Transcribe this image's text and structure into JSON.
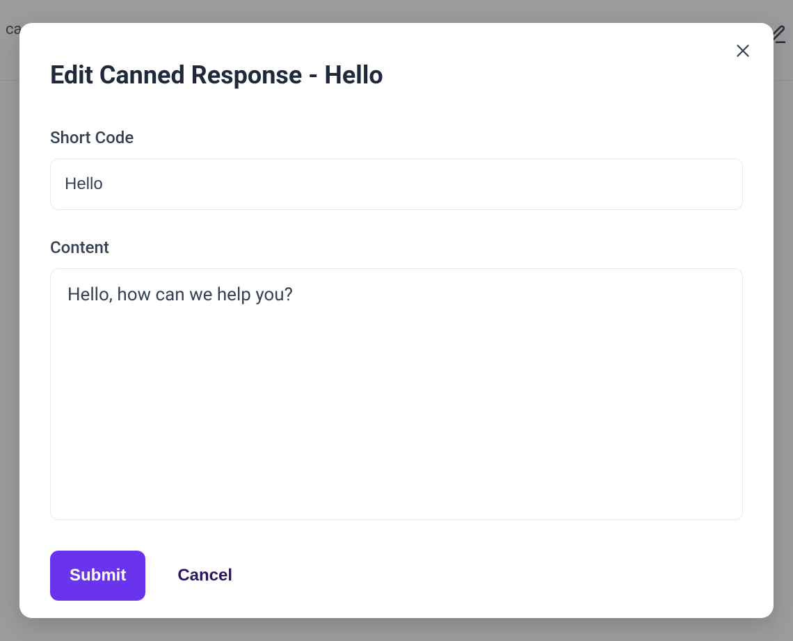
{
  "background": {
    "partial_text_left": "ca"
  },
  "modal": {
    "title": "Edit Canned Response - Hello",
    "fields": {
      "short_code": {
        "label": "Short Code",
        "value": "Hello"
      },
      "content": {
        "label": "Content",
        "value": "Hello, how can we help you?"
      }
    },
    "actions": {
      "submit_label": "Submit",
      "cancel_label": "Cancel"
    }
  }
}
